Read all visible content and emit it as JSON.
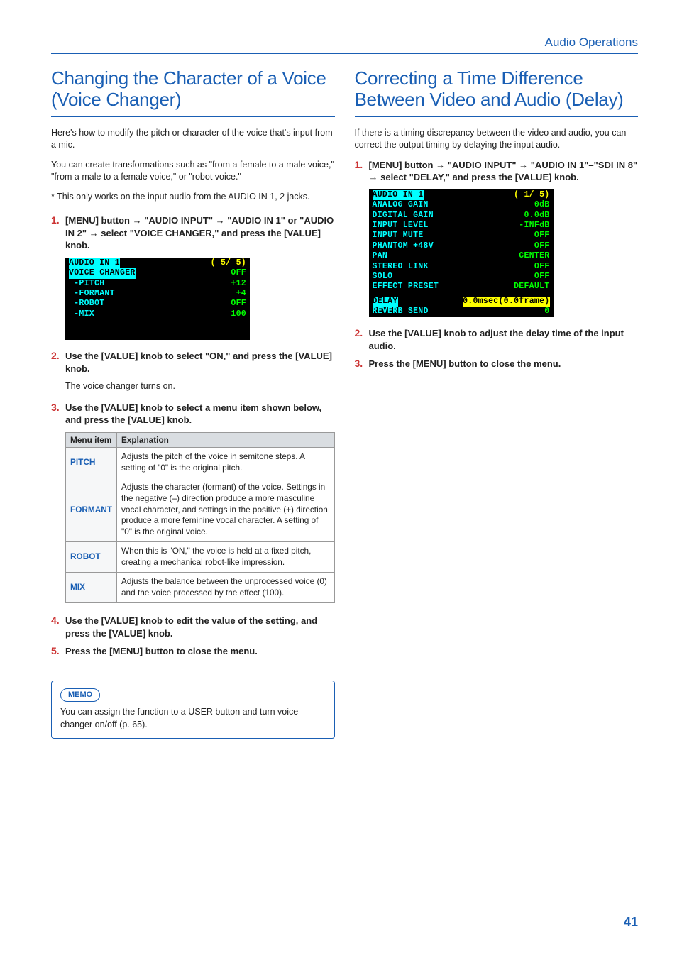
{
  "header": {
    "section": "Audio Operations"
  },
  "page_number": "41",
  "left": {
    "title": "Changing the Character of a Voice (Voice Changer)",
    "intro1": "Here's how to modify the pitch or character of the voice that's input from a mic.",
    "intro2": "You can create transformations such as \"from a female to a male voice,\" \"from a male to a female voice,\" or \"robot voice.\"",
    "note": "* This only works on the input audio from the AUDIO IN 1, 2 jacks.",
    "step1": {
      "num": "1.",
      "pre": "[MENU] button ",
      "m1": " \"AUDIO INPUT\" ",
      "m2": " \"AUDIO IN 1\" or \"AUDIO IN 2\" ",
      "post": " select \"VOICE CHANGER,\" and press the [VALUE] knob."
    },
    "ss1": {
      "r1l": "AUDIO IN 1",
      "r1r": "( 5/ 5)",
      "r2l": "VOICE CHANGER",
      "r2r": "OFF",
      "r3l": " -PITCH",
      "r3r": "+12",
      "r4l": " -FORMANT",
      "r4r": "+4",
      "r5l": " -ROBOT",
      "r5r": "OFF",
      "r6l": " -MIX",
      "r6r": "100"
    },
    "step2": {
      "num": "2.",
      "text": "Use the [VALUE] knob to select \"ON,\" and press the [VALUE] knob."
    },
    "step2_sub": "The voice changer turns on.",
    "step3": {
      "num": "3.",
      "text": "Use the [VALUE] knob to select a menu item shown below, and press the [VALUE] knob."
    },
    "table": {
      "h1": "Menu item",
      "h2": "Explanation",
      "r1l": "PITCH",
      "r1v": "Adjusts the pitch of the voice in semitone steps. A setting of \"0\" is the original pitch.",
      "r2l": "FORMANT",
      "r2v": "Adjusts the character (formant) of the voice. Settings in the negative (–) direction produce a more masculine vocal character, and settings in the positive (+) direction produce a more feminine vocal character. A setting of \"0\" is the original voice.",
      "r3l": "ROBOT",
      "r3v": "When this is \"ON,\" the voice is held at a fixed pitch, creating a mechanical robot-like impression.",
      "r4l": "MIX",
      "r4v": "Adjusts the balance between the unprocessed voice (0) and the voice processed by the effect (100)."
    },
    "step4": {
      "num": "4.",
      "text": "Use the [VALUE] knob to edit the value of the setting, and press the [VALUE] knob."
    },
    "step5": {
      "num": "5.",
      "text": "Press the [MENU] button to close the menu."
    },
    "memo": {
      "label": "MEMO",
      "text": "You can assign the function to a USER button and turn voice changer on/off (p. 65)."
    }
  },
  "right": {
    "title": "Correcting a Time Difference Between Video and Audio (Delay)",
    "intro": "If there is a timing discrepancy between the video and audio, you can correct the output timing by delaying the input audio.",
    "step1": {
      "num": "1.",
      "pre": "[MENU] button ",
      "m1": " \"AUDIO INPUT\" ",
      "m2": " \"AUDIO IN 1\"–\"SDI IN 8\" ",
      "post": " select \"DELAY,\" and press the [VALUE] knob."
    },
    "ss1": {
      "r1l": "AUDIO IN 1",
      "r1r": "( 1/ 5)",
      "r2l": "ANALOG GAIN",
      "r2r": "0dB",
      "r3l": "DIGITAL GAIN",
      "r3r": "0.0dB",
      "r4l": "INPUT LEVEL",
      "r4r": "-INFdB",
      "r5l": "INPUT MUTE",
      "r5r": "OFF",
      "r6l": "PHANTOM +48V",
      "r6r": "OFF",
      "r7l": "PAN",
      "r7r": "CENTER",
      "r8l": "STEREO LINK",
      "r8r": "OFF",
      "r9l": "SOLO",
      "r9r": "OFF",
      "r10l": "EFFECT PRESET",
      "r10r": "DEFAULT",
      "r11l": "DELAY",
      "r11r": "0.0msec(0.0frame)",
      "r12l": "REVERB SEND",
      "r12r": "0"
    },
    "step2": {
      "num": "2.",
      "text": "Use the [VALUE] knob to adjust the delay time of the input audio."
    },
    "step3": {
      "num": "3.",
      "text": "Press the [MENU] button to close the menu."
    }
  }
}
